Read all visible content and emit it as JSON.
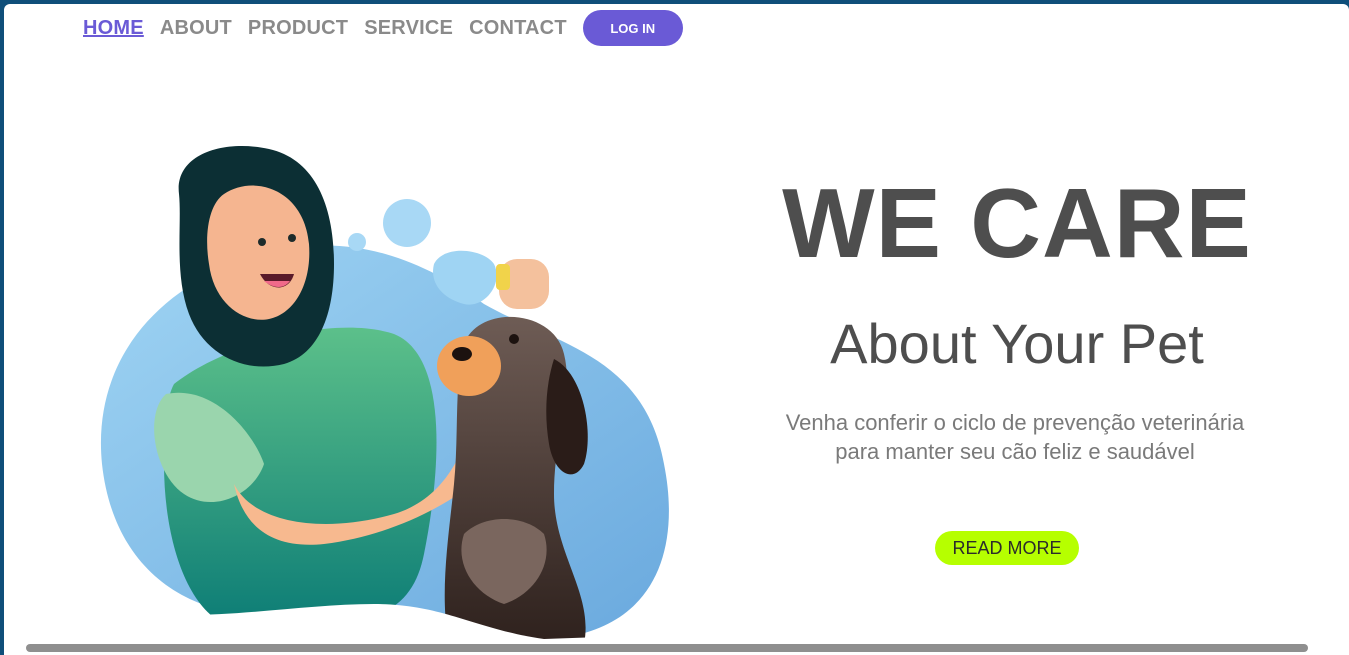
{
  "nav": {
    "items": [
      {
        "label": "HOME",
        "active": true
      },
      {
        "label": "ABOUT"
      },
      {
        "label": "PRODUCT"
      },
      {
        "label": "SERVICE"
      },
      {
        "label": "CONTACT"
      }
    ],
    "login_label": "LOG IN"
  },
  "hero": {
    "title": "WE CARE",
    "subtitle": "About Your Pet",
    "description": "Venha conferir o ciclo de prevenção veterinária para manter seu cão feliz e saudável",
    "cta_label": "READ MORE"
  },
  "colors": {
    "accent": "#6a5ad6",
    "cta": "#b6ff00",
    "text_dark": "#4e4e4e",
    "text_muted": "#7a7a7a",
    "window_border": "#0f4f7a"
  },
  "illustration": {
    "icon": "vet-woman-with-dog-illustration"
  }
}
